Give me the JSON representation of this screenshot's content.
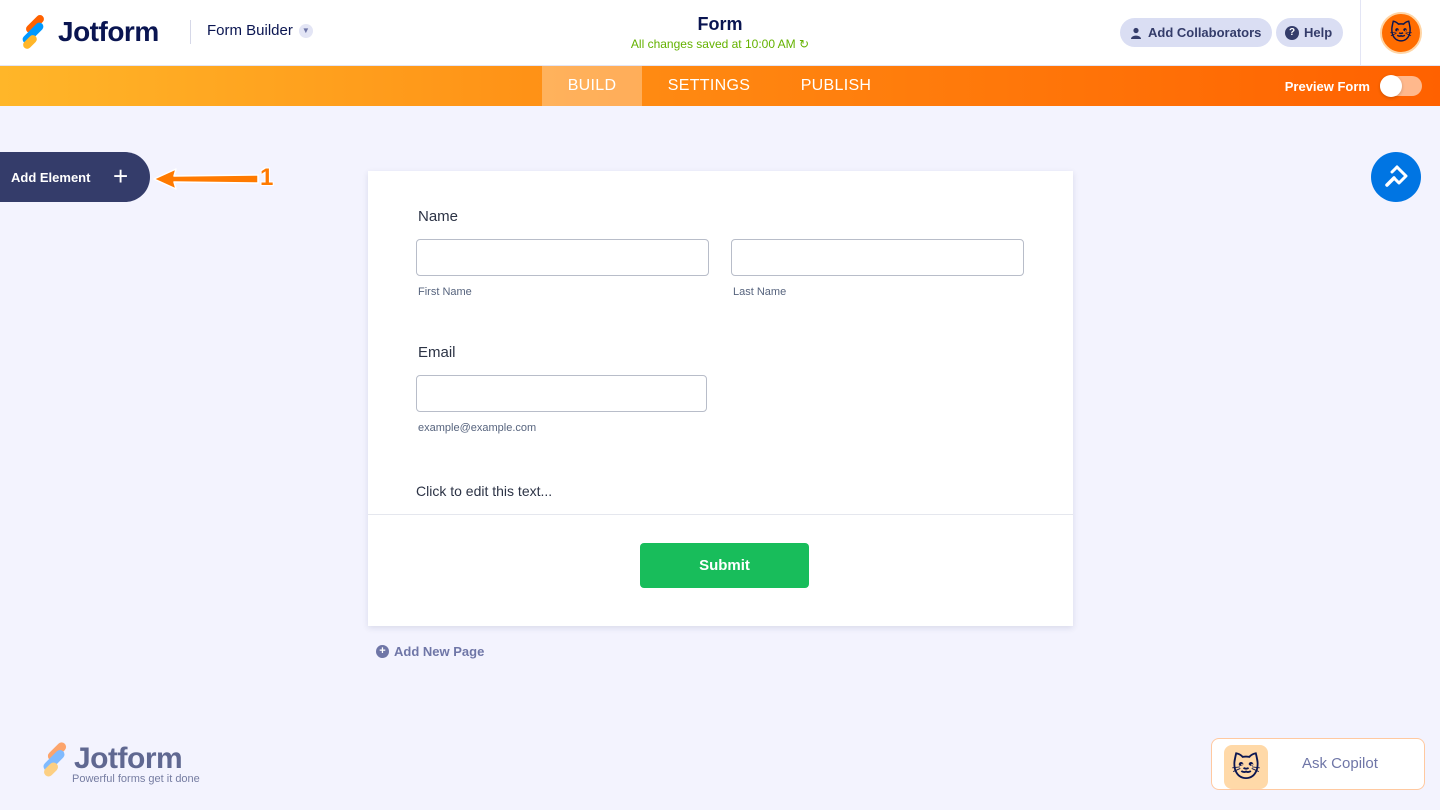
{
  "header": {
    "brand": "Jotform",
    "builder_menu": "Form Builder",
    "form_title": "Form",
    "save_status": "All changes saved at 10:00 AM",
    "add_collaborators": "Add Collaborators",
    "help": "Help"
  },
  "nav": {
    "tabs": [
      {
        "label": "BUILD",
        "active": true
      },
      {
        "label": "SETTINGS",
        "active": false
      },
      {
        "label": "PUBLISH",
        "active": false
      }
    ],
    "preview_label": "Preview Form",
    "preview_on": false
  },
  "sidebar": {
    "add_element": "Add Element"
  },
  "annotation": {
    "number": "1"
  },
  "form": {
    "name_label": "Name",
    "first_name_value": "",
    "last_name_value": "",
    "first_name_sublabel": "First Name",
    "last_name_sublabel": "Last Name",
    "email_label": "Email",
    "email_value": "",
    "email_sublabel": "example@example.com",
    "text_block": "Click to edit this text...",
    "submit": "Submit"
  },
  "add_new_page": "Add New Page",
  "footer_brand": {
    "name": "Jotform",
    "tagline": "Powerful forms get it done"
  },
  "copilot": {
    "label": "Ask Copilot"
  },
  "colors": {
    "accent_orange": "#ff6100",
    "navy": "#0a1551",
    "submit_green": "#18bd5b",
    "designer_blue": "#0075e3",
    "save_green": "#64b200"
  }
}
